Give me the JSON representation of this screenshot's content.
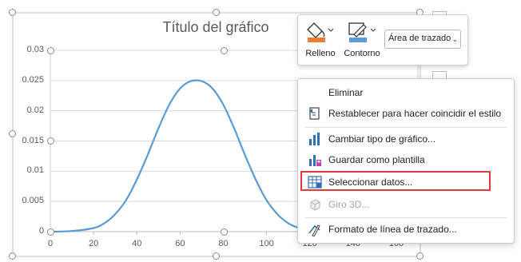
{
  "chart": {
    "title": "Título del gráfico"
  },
  "chart_data": {
    "type": "line",
    "title": "Título del gráfico",
    "xlabel": "",
    "ylabel": "",
    "xlim": [
      0,
      170
    ],
    "ylim": [
      0,
      0.03
    ],
    "x_ticks": [
      "0",
      "20",
      "40",
      "60",
      "80",
      "100",
      "120",
      "140",
      "160"
    ],
    "y_ticks": [
      "0",
      "0.005",
      "0.01",
      "0.015",
      "0.02",
      "0.025",
      "0.03"
    ],
    "series": [
      {
        "x": [
          0,
          10,
          20,
          25,
          30,
          35,
          40,
          45,
          50,
          55,
          60,
          65,
          70,
          75,
          80,
          85,
          90,
          95,
          100,
          105,
          110,
          115,
          120,
          130,
          140
        ],
        "y": [
          0.0,
          0.0001,
          0.0006,
          0.0014,
          0.0029,
          0.0052,
          0.0086,
          0.0127,
          0.0171,
          0.021,
          0.0237,
          0.0249,
          0.0249,
          0.0237,
          0.021,
          0.0171,
          0.0127,
          0.0086,
          0.0052,
          0.0029,
          0.0014,
          0.0006,
          0.0002,
          0.0,
          0.0
        ]
      }
    ],
    "line_color": "#5b9bd5",
    "grid": "horizontal"
  },
  "toolbar": {
    "fill_label": "Relleno",
    "outline_label": "Contorno",
    "fill_color": "#ed7d31",
    "outline_color": "#5b9bd5",
    "element_select": "Área de trazado"
  },
  "menu": {
    "items": [
      {
        "label": "Eliminar",
        "icon": "none",
        "enabled": true
      },
      {
        "label": "Restablecer para hacer coincidir el estilo",
        "icon": "reset-style-icon",
        "enabled": true
      },
      {
        "label": "Cambiar tipo de gráfico...",
        "icon": "change-chart-type-icon",
        "enabled": true
      },
      {
        "label": "Guardar como plantilla",
        "icon": "save-template-icon",
        "enabled": true
      },
      {
        "label": "Seleccionar datos...",
        "icon": "select-data-icon",
        "enabled": true
      },
      {
        "label": "Giro 3D...",
        "icon": "rotation-3d-icon",
        "enabled": false
      },
      {
        "label": "Formato de línea de trazado...",
        "icon": "format-line-icon",
        "enabled": true
      }
    ],
    "highlight_color": "#e03c3c"
  }
}
